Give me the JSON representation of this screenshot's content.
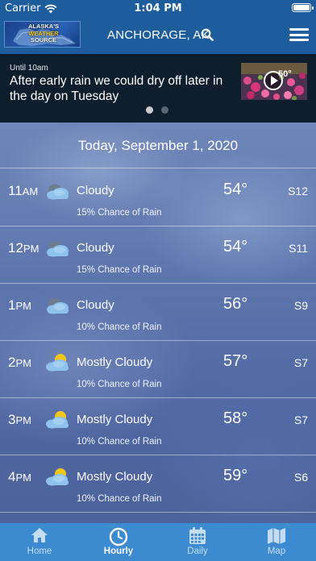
{
  "status_bar": {
    "carrier": "Carrier",
    "time": "1:04 PM"
  },
  "header": {
    "logo": {
      "line1": "ALASKA'S",
      "line2": "WEATHER",
      "line3": "SOURCE"
    },
    "location": "ANCHORAGE, AK"
  },
  "alert": {
    "until": "Until 10am",
    "headline": "After early rain we could dry off later in the day on Tuesday",
    "thumbnail_temp": "50°"
  },
  "hourly": {
    "date_title": "Today, September 1, 2020",
    "rows": [
      {
        "hour": "11",
        "ampm": "AM",
        "icon": "cloudy-icon",
        "condition": "Cloudy",
        "temp": "54°",
        "wind": "S12",
        "rain": "15% Chance of Rain"
      },
      {
        "hour": "12",
        "ampm": "PM",
        "icon": "cloudy-icon",
        "condition": "Cloudy",
        "temp": "54°",
        "wind": "S11",
        "rain": "15% Chance of Rain"
      },
      {
        "hour": "1",
        "ampm": "PM",
        "icon": "cloudy-icon",
        "condition": "Cloudy",
        "temp": "56°",
        "wind": "S9",
        "rain": "10% Chance of Rain"
      },
      {
        "hour": "2",
        "ampm": "PM",
        "icon": "mostly-cloudy-icon",
        "condition": "Mostly Cloudy",
        "temp": "57°",
        "wind": "S7",
        "rain": "10% Chance of Rain"
      },
      {
        "hour": "3",
        "ampm": "PM",
        "icon": "mostly-cloudy-icon",
        "condition": "Mostly Cloudy",
        "temp": "58°",
        "wind": "S7",
        "rain": "10% Chance of Rain"
      },
      {
        "hour": "4",
        "ampm": "PM",
        "icon": "mostly-cloudy-icon",
        "condition": "Mostly Cloudy",
        "temp": "59°",
        "wind": "S6",
        "rain": "10% Chance of Rain"
      }
    ]
  },
  "tabs": [
    {
      "label": "Home",
      "icon": "home-icon",
      "active": false
    },
    {
      "label": "Hourly",
      "icon": "clock-icon",
      "active": true
    },
    {
      "label": "Daily",
      "icon": "calendar-icon",
      "active": false
    },
    {
      "label": "Map",
      "icon": "map-icon",
      "active": false
    }
  ],
  "colors": {
    "header_blue": "#1d5d9c",
    "tabbar_blue": "#3c8bd0",
    "alert_bg": "#0f1e2c",
    "sun_yellow": "#f5c518"
  }
}
